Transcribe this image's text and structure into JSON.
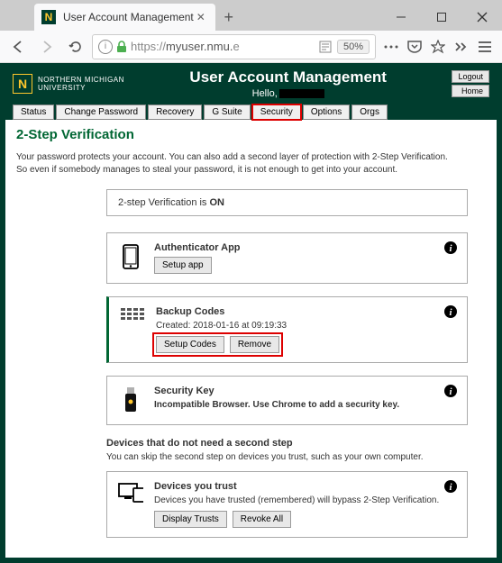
{
  "browser": {
    "tab_title": "User Account Management",
    "url_proto": "https://",
    "url_host": "myuser.nmu.",
    "url_rest": "e",
    "zoom": "50%"
  },
  "header": {
    "uni_line1": "NORTHERN MICHIGAN",
    "uni_line2": "UNIVERSITY",
    "title": "User Account Management",
    "hello": "Hello,",
    "logout": "Logout",
    "home": "Home"
  },
  "tabs": {
    "status": "Status",
    "change_password": "Change Password",
    "recovery": "Recovery",
    "gsuite": "G Suite",
    "security": "Security",
    "options": "Options",
    "orgs": "Orgs"
  },
  "page_title": "2-Step Verification",
  "intro1": "Your password protects your account. You can also add a second layer of protection with 2-Step Verification.",
  "intro2": "So even if somebody manages to steal your password, it is not enough to get into your account.",
  "status_pre": "2-step Verification is ",
  "status_val": "ON",
  "auth": {
    "title": "Authenticator App",
    "setup": "Setup app"
  },
  "backup": {
    "title": "Backup Codes",
    "created": "Created: 2018-01-16 at 09:19:33",
    "setup": "Setup Codes",
    "remove": "Remove"
  },
  "seckey": {
    "title": "Security Key",
    "msg": "Incompatible Browser. Use Chrome to add a security key."
  },
  "devices": {
    "heading": "Devices that do not need a second step",
    "sub": "You can skip the second step on devices you trust, such as your own computer.",
    "card_title": "Devices you trust",
    "card_sub": "Devices you have trusted (remembered) will bypass 2-Step Verification.",
    "display": "Display Trusts",
    "revoke": "Revoke All"
  }
}
